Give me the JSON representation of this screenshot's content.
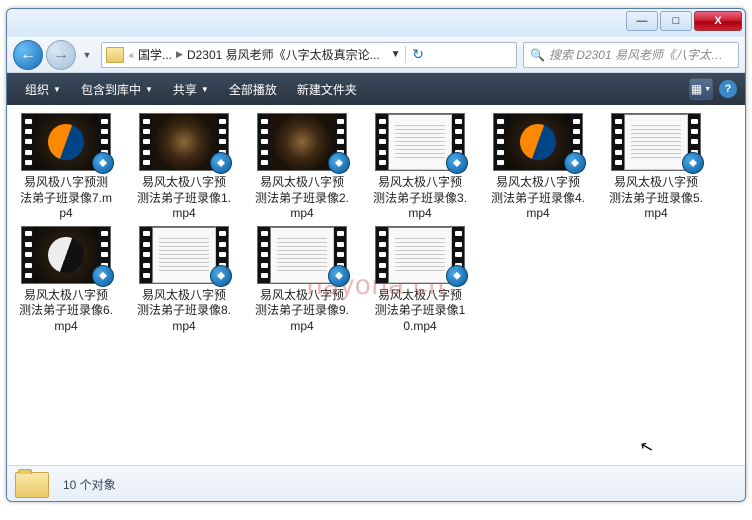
{
  "titlebar": {
    "min": "—",
    "max": "□",
    "close": "X"
  },
  "nav": {
    "back": "←",
    "fwd": "→",
    "dd": "▼",
    "refresh": "↻"
  },
  "breadcrumb": {
    "sep1": "«",
    "p1": "国学...",
    "s1": "▶",
    "p2": "D2301 易风老师《八字太极真宗论...",
    "dd": "▼"
  },
  "search": {
    "icon": "🔍",
    "placeholder": "搜索 D2301 易风老师《八字太极..."
  },
  "toolbar": {
    "organize": "组织",
    "include": "包含到库中",
    "share": "共享",
    "playall": "全部播放",
    "newfolder": "新建文件夹",
    "dd": "▼",
    "help": "?"
  },
  "files": [
    {
      "name": "易风极八字预测法弟子班录像7.mp4",
      "style": "taichi"
    },
    {
      "name": "易风太极八字预测法弟子班录像1.mp4",
      "style": "dark"
    },
    {
      "name": "易风太极八字预测法弟子班录像2.mp4",
      "style": "dark"
    },
    {
      "name": "易风太极八字预测法弟子班录像3.mp4",
      "style": "white"
    },
    {
      "name": "易风太极八字预测法弟子班录像4.mp4",
      "style": "taichi"
    },
    {
      "name": "易风太极八字预测法弟子班录像5.mp4",
      "style": "white"
    },
    {
      "name": "易风太极八字预测法弟子班录像6.mp4",
      "style": "taichi-bw"
    },
    {
      "name": "易风太极八字预测法弟子班录像8.mp4",
      "style": "white"
    },
    {
      "name": "易风太极八字预测法弟子班录像9.mp4",
      "style": "white"
    },
    {
      "name": "易风太极八字预测法弟子班录像10.mp4",
      "style": "white"
    }
  ],
  "status": {
    "text": "10 个对象"
  },
  "watermark": "nayona.cn"
}
